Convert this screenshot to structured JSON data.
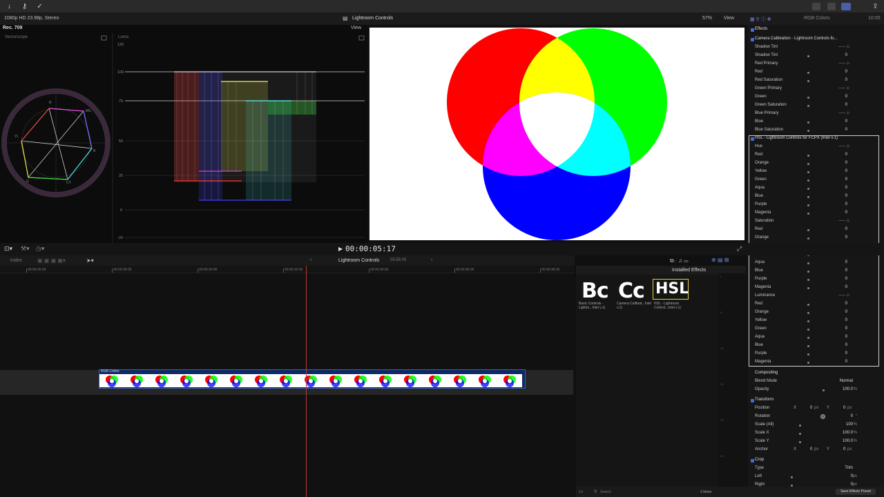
{
  "topbar": {
    "status": "10:00"
  },
  "viewer_header": {
    "format": "1080p HD 23.98p, Stereo",
    "title": "Lightroom Controls",
    "zoom": "57%",
    "view": "View",
    "rgb_label": "RGB Colors",
    "timecode": "10:00"
  },
  "scopes": {
    "colorspace": "Rec. 709",
    "view": "View",
    "vectorscope_label": "Vectorscope",
    "luma_label": "Luma",
    "vs_labels": [
      "R",
      "MG",
      "B",
      "CY",
      "G",
      "YL"
    ],
    "luma_ticks": [
      "120",
      "100",
      "79",
      "50",
      "25",
      "0",
      "-20"
    ]
  },
  "midbar": {
    "timecode": "00:00:05:17"
  },
  "timeline": {
    "index_label": "Index",
    "project": "Lightroom Controls",
    "duration": "05:55:05",
    "ruler": [
      "00:00:26:00",
      "00:00:28:00",
      "00:00:30:00",
      "00:00:32:00",
      "00:00:34:00",
      "00:00:36:00",
      "00:00:38:00"
    ],
    "clip_title": "RGB Colors"
  },
  "effects": {
    "header": "Installed Effects",
    "items": [
      {
        "icon": "Bc",
        "label": "Basic Controls - Lightro...Intel v.1)"
      },
      {
        "icon": "Cc",
        "label": "Camera Calibrat...Intel v.1)"
      },
      {
        "icon": "HSL",
        "label": "HSL - Lightroom Control...Intel v.1)"
      }
    ],
    "search_placeholder": "Search",
    "count": "3 Items",
    "meter_ticks": [
      "0",
      "-6",
      "-12",
      "-20",
      "-30",
      "-40",
      "-50"
    ]
  },
  "inspector": {
    "effects_label": "Effects",
    "cc_title": "Camera Calibration - Lightroom Controls fo...",
    "cc_rows": [
      {
        "l": "Shadow Tint",
        "v": "0",
        "t": "dash"
      },
      {
        "l": "Shadow Tint",
        "v": "0",
        "t": "dial"
      },
      {
        "l": "Red Primary",
        "v": "0",
        "t": "dash"
      },
      {
        "l": "Red",
        "v": "0",
        "t": "dial"
      },
      {
        "l": "Red Saturation",
        "v": "0",
        "t": "dial"
      },
      {
        "l": "Green Primary",
        "v": "0",
        "t": "dash"
      },
      {
        "l": "Green",
        "v": "0",
        "t": "dial"
      },
      {
        "l": "Green Saturation",
        "v": "0",
        "t": "dial"
      },
      {
        "l": "Blue Primary",
        "v": "0",
        "t": "dash"
      },
      {
        "l": "Blue",
        "v": "0",
        "t": "dial"
      },
      {
        "l": "Blue Saturation",
        "v": "0",
        "t": "dial"
      }
    ],
    "hsl_title": "HSL - Lightroom Controls for FCPX (Intel v.1)",
    "hsl_rows": [
      {
        "l": "Hue",
        "v": "0",
        "t": "dash"
      },
      {
        "l": "Red",
        "v": "0",
        "t": "dial"
      },
      {
        "l": "Orange",
        "v": "0",
        "t": "dial"
      },
      {
        "l": "Yellow",
        "v": "0",
        "t": "dial"
      },
      {
        "l": "Green",
        "v": "0",
        "t": "dial"
      },
      {
        "l": "Aqua",
        "v": "0",
        "t": "dial"
      },
      {
        "l": "Blue",
        "v": "0",
        "t": "dial"
      },
      {
        "l": "Purple",
        "v": "0",
        "t": "dial"
      },
      {
        "l": "Magenta",
        "v": "0",
        "t": "dial"
      },
      {
        "l": "Saturation",
        "v": "0",
        "t": "dash"
      },
      {
        "l": "Red",
        "v": "0",
        "t": "dial"
      },
      {
        "l": "Orange",
        "v": "0",
        "t": "dial"
      },
      {
        "l": "Yellow",
        "v": "0",
        "t": "dial"
      },
      {
        "l": "Green",
        "v": "0",
        "t": "dial"
      },
      {
        "l": "Aqua",
        "v": "0",
        "t": "dial"
      },
      {
        "l": "Blue",
        "v": "0",
        "t": "dial"
      },
      {
        "l": "Purple",
        "v": "0",
        "t": "dial"
      },
      {
        "l": "Magenta",
        "v": "0",
        "t": "dial"
      },
      {
        "l": "Luminance",
        "v": "0",
        "t": "dash"
      },
      {
        "l": "Red",
        "v": "0",
        "t": "dial"
      },
      {
        "l": "Orange",
        "v": "0",
        "t": "dial"
      },
      {
        "l": "Yellow",
        "v": "0",
        "t": "dial"
      },
      {
        "l": "Green",
        "v": "0",
        "t": "dial"
      },
      {
        "l": "Aqua",
        "v": "0",
        "t": "dial"
      },
      {
        "l": "Blue",
        "v": "0",
        "t": "dial"
      },
      {
        "l": "Purple",
        "v": "0",
        "t": "dial"
      },
      {
        "l": "Magenta",
        "v": "0",
        "t": "dial"
      }
    ],
    "compositing": "Compositing",
    "blend_mode_label": "Blend Mode",
    "blend_mode": "Normal",
    "opacity_label": "Opacity",
    "opacity": "100.0",
    "pct": "%",
    "transform": "Transform",
    "position_label": "Position",
    "rotation_label": "Rotation",
    "rotation": "0",
    "deg": "°",
    "scale_all_label": "Scale (All)",
    "scale_all": "100",
    "scale_x_label": "Scale X",
    "scale_x": "100.0",
    "scale_y_label": "Scale Y",
    "scale_y": "100.0",
    "anchor_label": "Anchor",
    "x": "X",
    "y": "Y",
    "zero": "0",
    "px": "px",
    "crop": "Crop",
    "type_label": "Type",
    "type": "Trim",
    "left_label": "Left",
    "left": "0",
    "right_label": "Right",
    "right": "0",
    "save_preset": "Save Effects Preset"
  }
}
